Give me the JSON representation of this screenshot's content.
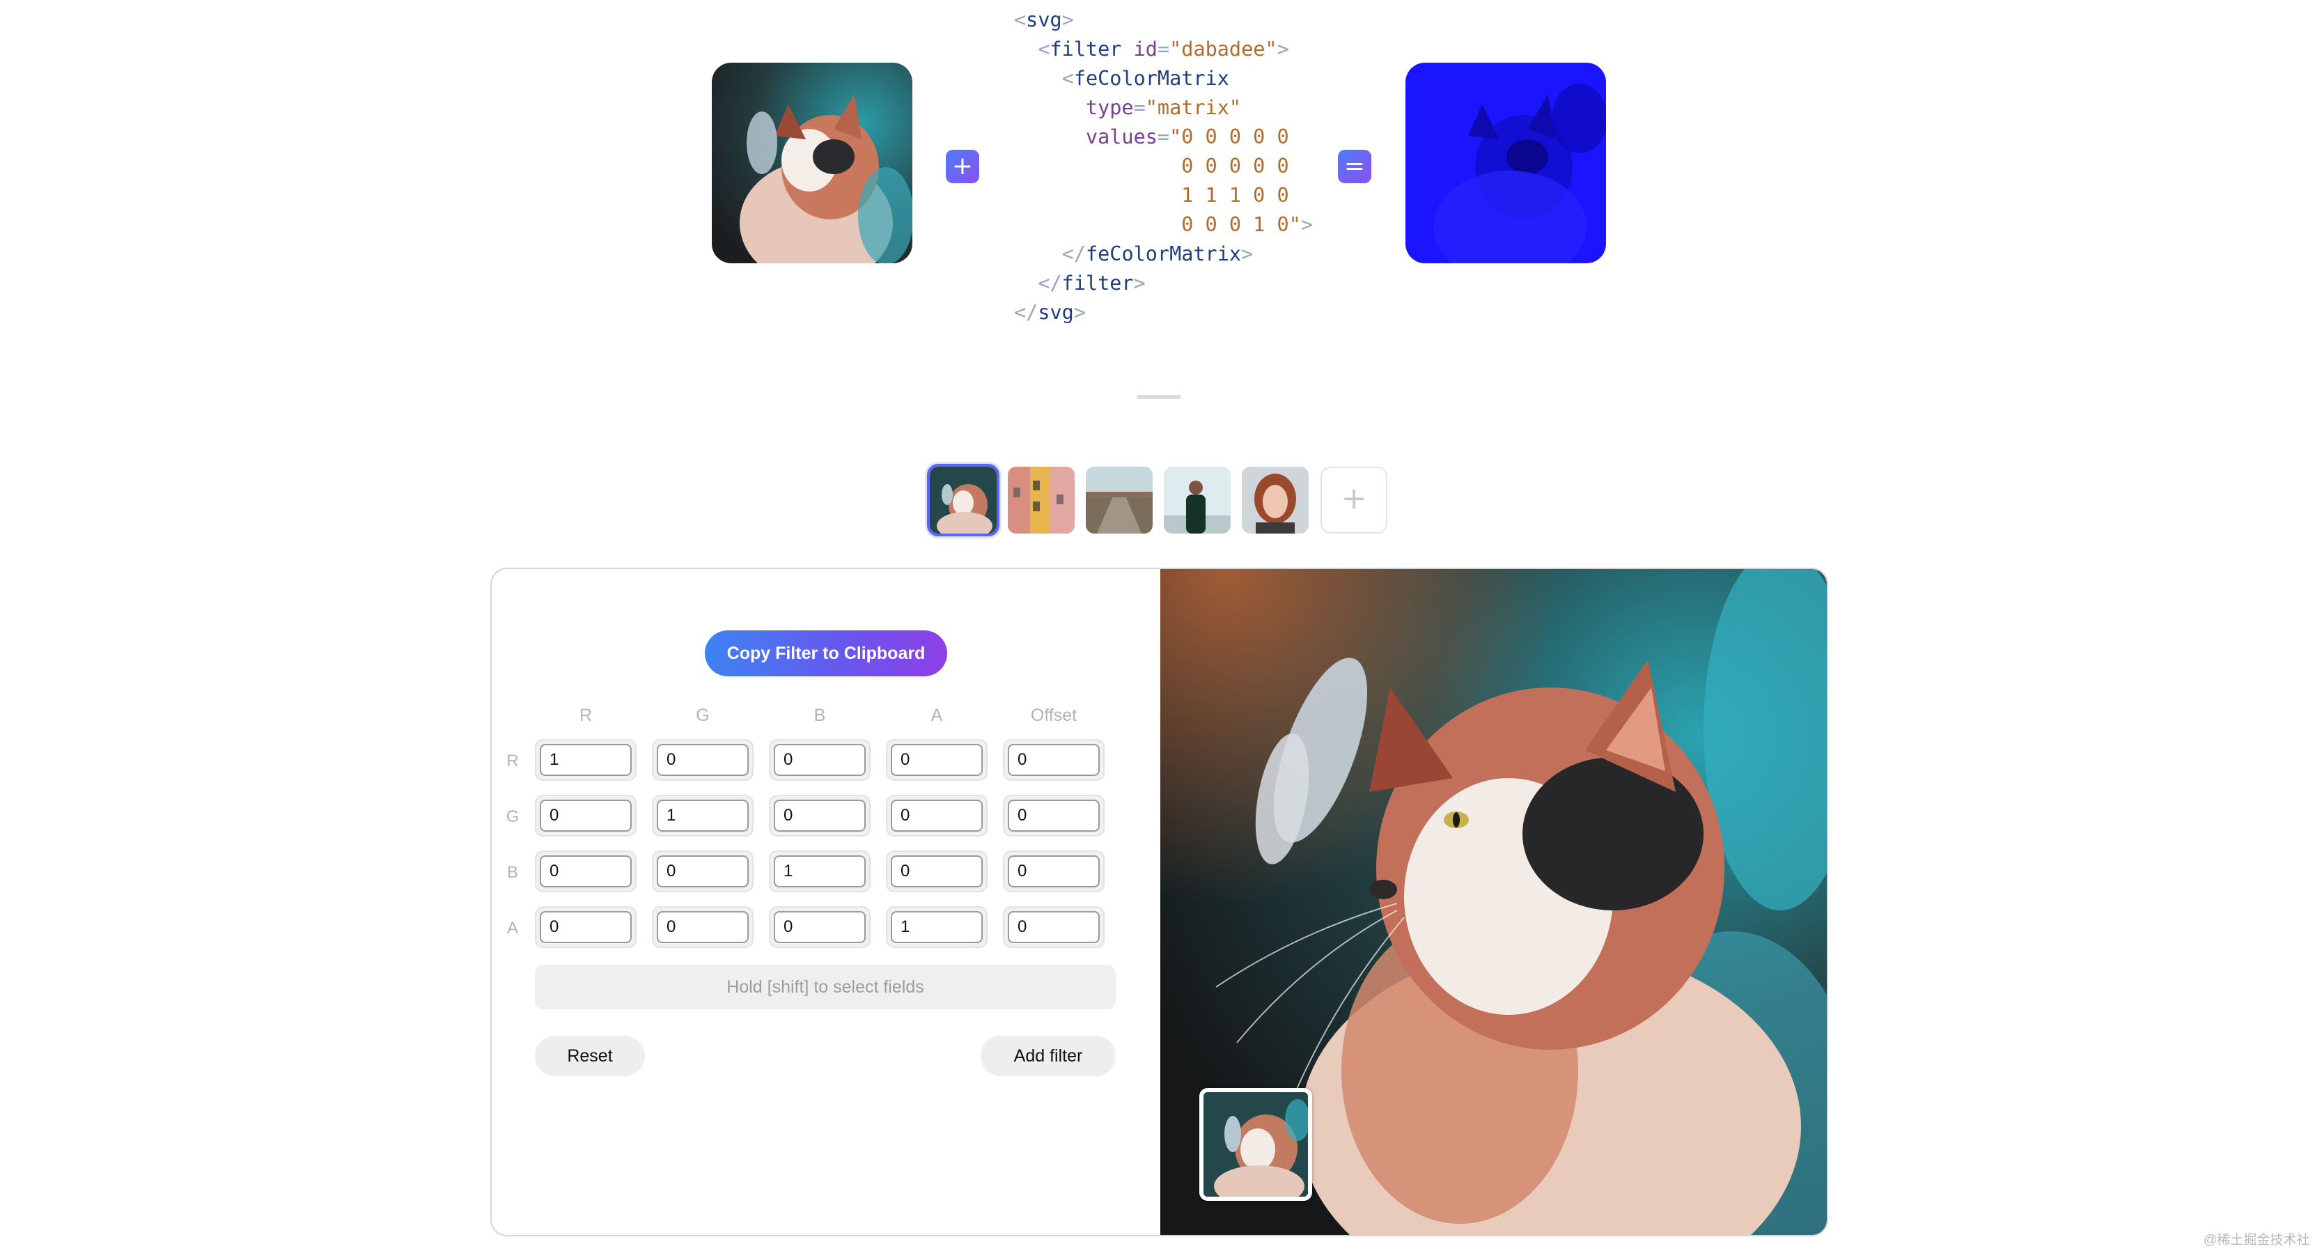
{
  "hero": {
    "plus_icon": "plus-icon",
    "equals_icon": "equals-icon",
    "code": {
      "svg_open_tag": "svg",
      "filter_tag": "filter",
      "id_attr": "id",
      "id_value": "\"dabadee\"",
      "matrix_tag": "feColorMatrix",
      "type_attr": "type",
      "type_value": "\"matrix\"",
      "values_attr": "values",
      "values_line1": "\"0 0 0 0 0",
      "values_line2": "0 0 0 0 0",
      "values_line3": "1 1 1 0 0",
      "values_line4": "0 0 0 1 0\""
    }
  },
  "thumbnails": {
    "items": [
      "cat",
      "buildings",
      "road",
      "person",
      "portrait"
    ],
    "add_label": "+"
  },
  "editor": {
    "copy_button": "Copy Filter to Clipboard",
    "columns": [
      "R",
      "G",
      "B",
      "A",
      "Offset"
    ],
    "rows": [
      "R",
      "G",
      "B",
      "A"
    ],
    "matrix": [
      [
        "1",
        "0",
        "0",
        "0",
        "0"
      ],
      [
        "0",
        "1",
        "0",
        "0",
        "0"
      ],
      [
        "0",
        "0",
        "1",
        "0",
        "0"
      ],
      [
        "0",
        "0",
        "0",
        "1",
        "0"
      ]
    ],
    "shift_hint": "Hold [shift] to select fields",
    "reset_button": "Reset",
    "add_filter_button": "Add filter"
  },
  "watermark": "@稀土掘金技术社区",
  "colors": {
    "accent_start": "#3d83f2",
    "accent_end": "#8f3fe6",
    "filtered_blue": "#1a14ff"
  }
}
